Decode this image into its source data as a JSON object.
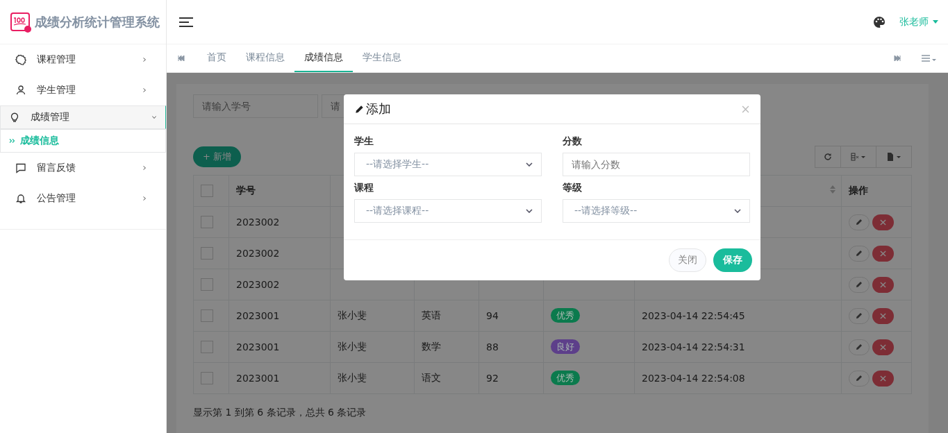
{
  "brand": {
    "title": "成绩分析统计管理系统"
  },
  "sidebar": {
    "items": [
      {
        "label": "课程管理",
        "expanded": false,
        "selected": false
      },
      {
        "label": "学生管理",
        "expanded": false,
        "selected": false
      },
      {
        "label": "成绩管理",
        "expanded": true,
        "selected": true,
        "children": [
          {
            "label": "成绩信息",
            "selected": true
          }
        ]
      },
      {
        "label": "留言反馈",
        "expanded": false,
        "selected": false
      },
      {
        "label": "公告管理",
        "expanded": false,
        "selected": false
      }
    ]
  },
  "header": {
    "user": "张老师"
  },
  "tabs": [
    {
      "label": "首页",
      "selected": false
    },
    {
      "label": "课程信息",
      "selected": false
    },
    {
      "label": "成绩信息",
      "selected": true
    },
    {
      "label": "学生信息",
      "selected": false
    }
  ],
  "search": [
    {
      "placeholder": "请输入学号"
    },
    {
      "placeholder": "请"
    }
  ],
  "add_button": "+ 新增",
  "table": {
    "columns": [
      "学号",
      "",
      "",
      "",
      "",
      "",
      "操作"
    ],
    "all_checked": false,
    "rows": [
      {
        "checked": false,
        "id": "2023002"
      },
      {
        "checked": false,
        "id": "2023002"
      },
      {
        "checked": false,
        "id": "2023002"
      },
      {
        "checked": false,
        "id": "2023001",
        "name": "张小斐",
        "course": "英语",
        "score": "94",
        "grade": {
          "label": "优秀",
          "color": "#0b7a4d"
        },
        "time": "2023-04-14 22:54:45"
      },
      {
        "checked": false,
        "id": "2023001",
        "name": "张小斐",
        "course": "数学",
        "score": "88",
        "grade": {
          "label": "良好",
          "color": "#5d3f8a"
        },
        "time": "2023-04-14 22:54:31"
      },
      {
        "checked": false,
        "id": "2023001",
        "name": "张小斐",
        "course": "语文",
        "score": "92",
        "grade": {
          "label": "优秀",
          "color": "#0b7a4d"
        },
        "time": "2023-04-14 22:54:08"
      }
    ]
  },
  "pagination": "显示第 1 到第 6 条记录，总共 6 条记录",
  "modal": {
    "title": "添加",
    "fields": [
      {
        "label": "学生",
        "kind": "select",
        "placeholder": "--请选择学生--"
      },
      {
        "label": "分数",
        "kind": "input",
        "placeholder": "请输入分数"
      },
      {
        "label": "课程",
        "kind": "select",
        "placeholder": "--请选择课程--"
      },
      {
        "label": "等级",
        "kind": "select",
        "placeholder": "--请选择等级--"
      }
    ],
    "buttons": [
      {
        "label": "关闭",
        "kind": "secondary"
      },
      {
        "label": "保存",
        "kind": "primary"
      }
    ]
  }
}
